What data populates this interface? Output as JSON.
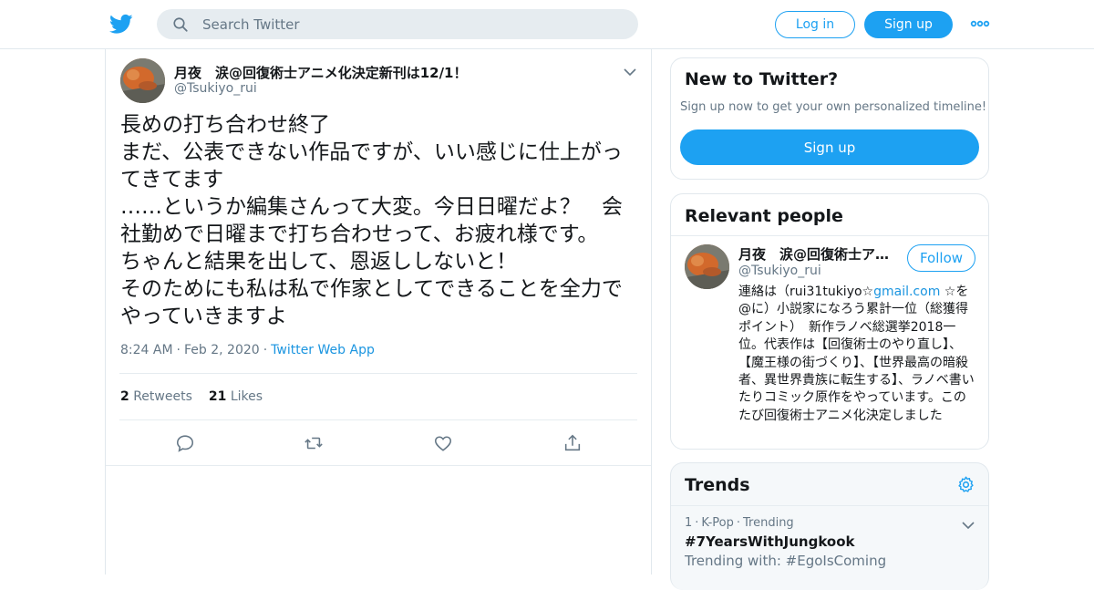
{
  "header": {
    "search_placeholder": "Search Twitter",
    "login_label": "Log in",
    "signup_label": "Sign up",
    "more_icon": "more-icon",
    "logo_icon": "twitter-bird-icon"
  },
  "tweet": {
    "author_name": "月夜　涙@回復術士アニメ化決定新刊は12/1！",
    "author_handle": "@Tsukiyo_rui",
    "text": "長めの打ち合わせ終了\nまだ、公表できない作品ですが、いい感じに仕上がってきてます\n……というか編集さんって大変。今日日曜だよ？　会社勤めで日曜まで打ち合わせって、お疲れ様です。\nちゃんと結果を出して、恩返ししないと！\nそのためにも私は私で作家としてできることを全力でやっていきますよ",
    "time": "8:24 AM",
    "date": "Feb 2, 2020",
    "source": "Twitter Web App",
    "retweets_count": "2",
    "retweets_label": "Retweets",
    "likes_count": "21",
    "likes_label": "Likes",
    "actions": [
      "reply-icon",
      "retweet-icon",
      "like-icon",
      "share-icon"
    ]
  },
  "new_to_twitter": {
    "title": "New to Twitter?",
    "subtitle": "Sign up now to get your own personalized timeline!",
    "signup_label": "Sign up"
  },
  "relevant_people": {
    "title": "Relevant people",
    "name": "月夜　涙@回復術士ア…",
    "handle": "@Tsukiyo_rui",
    "follow_label": "Follow",
    "bio_prefix": "連絡は（rui31tukiyo☆",
    "bio_link": "gmail.com",
    "bio_suffix": " ☆を@に）小説家になろう累計一位（総獲得ポイント）　新作ラノベ総選挙2018一位。代表作は【回復術士のやり直し】、【魔王様の街づくり】、【世界最高の暗殺者、異世界貴族に転生する】、ラノベ書いたりコミック原作をやっています。このたび回復術士アニメ化決定しました"
  },
  "trends": {
    "title": "Trends",
    "item_rank": "1",
    "item_category": "K-Pop",
    "item_status": "Trending",
    "item_name": "#7YearsWithJungkook",
    "item_with": "Trending with: #EgoIsComing"
  },
  "colors": {
    "accent": "#1da1f2",
    "link": "#1b95e0",
    "muted": "#657786",
    "border": "#e1e8ed"
  }
}
